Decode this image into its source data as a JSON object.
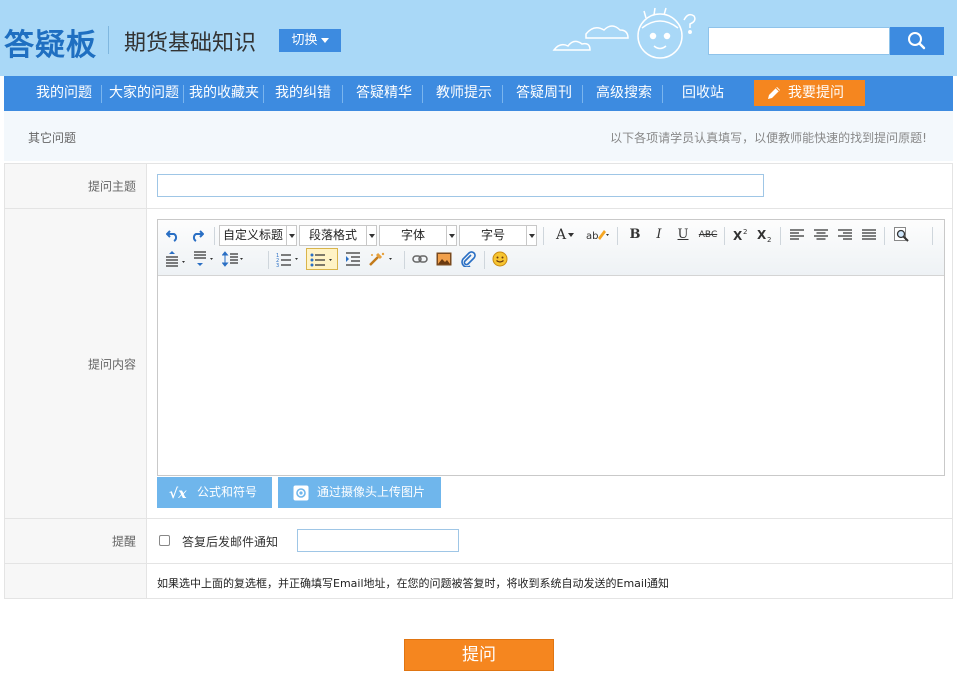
{
  "header": {
    "logo": "答疑板",
    "subject": "期货基础知识",
    "switch_label": "切换",
    "search_placeholder": ""
  },
  "nav": {
    "items": [
      "我的问题",
      "大家的问题",
      "我的收藏夹",
      "我的纠错",
      "答疑精华",
      "教师提示",
      "答疑周刊",
      "高级搜索",
      "回收站"
    ],
    "ask_label": "我要提问"
  },
  "info": {
    "left": "其它问题",
    "right": "以下各项请学员认真填写，以便教师能快速的找到提问原题!"
  },
  "form": {
    "subject_label": "提问主题",
    "subject_value": "",
    "content_label": "提问内容",
    "remind_label": "提醒",
    "email_checkbox_label": "答复后发邮件通知",
    "email_value": "",
    "note": "如果选中上面的复选框，并正确填写Email地址，在您的问题被答复时，将收到系统自动发送的Email通知"
  },
  "editor": {
    "combo_heading": "自定义标题",
    "combo_paragraph": "段落格式",
    "combo_font": "字体",
    "combo_size": "字号",
    "bold": "B",
    "italic": "I",
    "underline": "U",
    "strike": "ABC",
    "font_color": "A",
    "formula_btn": "公式和符号",
    "camera_btn": "通过摄像头上传图片"
  },
  "submit_label": "提问",
  "colors": {
    "header_bg": "#a9d8f7",
    "nav_bg": "#3d8be0",
    "accent_orange": "#f5861f",
    "light_blue_btn": "#6fb6ec"
  }
}
